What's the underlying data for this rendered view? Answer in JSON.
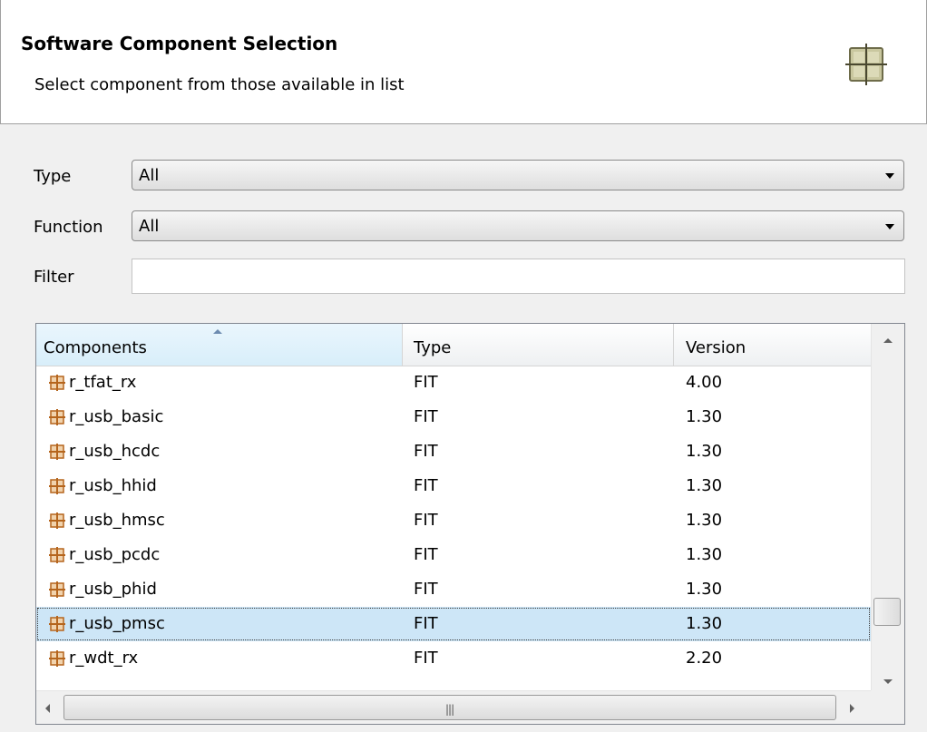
{
  "header": {
    "title": "Software Component Selection",
    "subtitle": "Select component from those available in list",
    "icon": "component-wizard-icon"
  },
  "form": {
    "type_label": "Type",
    "type_value": "All",
    "function_label": "Function",
    "function_value": "All",
    "filter_label": "Filter",
    "filter_value": ""
  },
  "table": {
    "columns": {
      "components": "Components",
      "type": "Type",
      "version": "Version"
    },
    "sort": {
      "column": "Components",
      "direction": "ascending"
    },
    "selected_row": "r_usb_pmsc",
    "rows": [
      {
        "name": "r_tfat_rx",
        "type": "FIT",
        "version": "4.00",
        "icon": "fit-module-icon"
      },
      {
        "name": "r_usb_basic",
        "type": "FIT",
        "version": "1.30",
        "icon": "fit-module-icon"
      },
      {
        "name": "r_usb_hcdc",
        "type": "FIT",
        "version": "1.30",
        "icon": "fit-module-icon"
      },
      {
        "name": "r_usb_hhid",
        "type": "FIT",
        "version": "1.30",
        "icon": "fit-module-icon"
      },
      {
        "name": "r_usb_hmsc",
        "type": "FIT",
        "version": "1.30",
        "icon": "fit-module-icon"
      },
      {
        "name": "r_usb_pcdc",
        "type": "FIT",
        "version": "1.30",
        "icon": "fit-module-icon"
      },
      {
        "name": "r_usb_phid",
        "type": "FIT",
        "version": "1.30",
        "icon": "fit-module-icon"
      },
      {
        "name": "r_usb_pmsc",
        "type": "FIT",
        "version": "1.30",
        "icon": "fit-module-icon"
      },
      {
        "name": "r_wdt_rx",
        "type": "FIT",
        "version": "2.20",
        "icon": "fit-module-icon"
      }
    ]
  },
  "colors": {
    "selection": "#cde6f7",
    "fit_icon": "#b5651d",
    "header_bg": "#ffffff",
    "dialog_bg": "#f0f0f0"
  }
}
